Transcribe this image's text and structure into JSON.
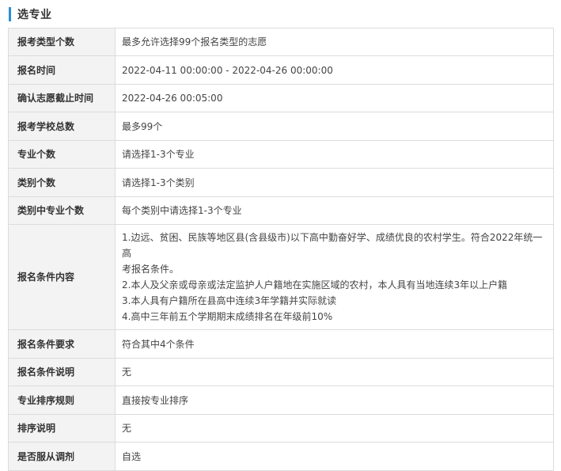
{
  "section": {
    "title": "选专业"
  },
  "rows": [
    {
      "label": "报考类型个数",
      "value": "最多允许选择99个报名类型的志愿"
    },
    {
      "label": "报名时间",
      "value": "2022-04-11 00:00:00 - 2022-04-26 00:00:00"
    },
    {
      "label": "确认志愿截止时间",
      "value": "2022-04-26 00:05:00"
    },
    {
      "label": "报考学校总数",
      "value": "最多99个"
    },
    {
      "label": "专业个数",
      "value": "请选择1-3个专业"
    },
    {
      "label": "类别个数",
      "value": "请选择1-3个类别"
    },
    {
      "label": "类别中专业个数",
      "value": "每个类别中请选择1-3个专业"
    },
    {
      "label": "报名条件内容",
      "lines": [
        "1.边远、贫困、民族等地区县(含县级市)以下高中勤奋好学、成绩优良的农村学生。符合2022年统一高",
        "考报名条件。",
        "2.本人及父亲或母亲或法定监护人户籍地在实施区域的农村，本人具有当地连续3年以上户籍",
        "3.本人具有户籍所在县高中连续3年学籍并实际就读",
        "4.高中三年前五个学期期末成绩排名在年级前10%"
      ]
    },
    {
      "label": "报名条件要求",
      "value": "符合其中4个条件"
    },
    {
      "label": "报名条件说明",
      "value": "无"
    },
    {
      "label": "专业排序规则",
      "value": "直接按专业排序"
    },
    {
      "label": "排序说明",
      "value": "无"
    },
    {
      "label": "是否服从调剂",
      "value": "自选"
    }
  ]
}
